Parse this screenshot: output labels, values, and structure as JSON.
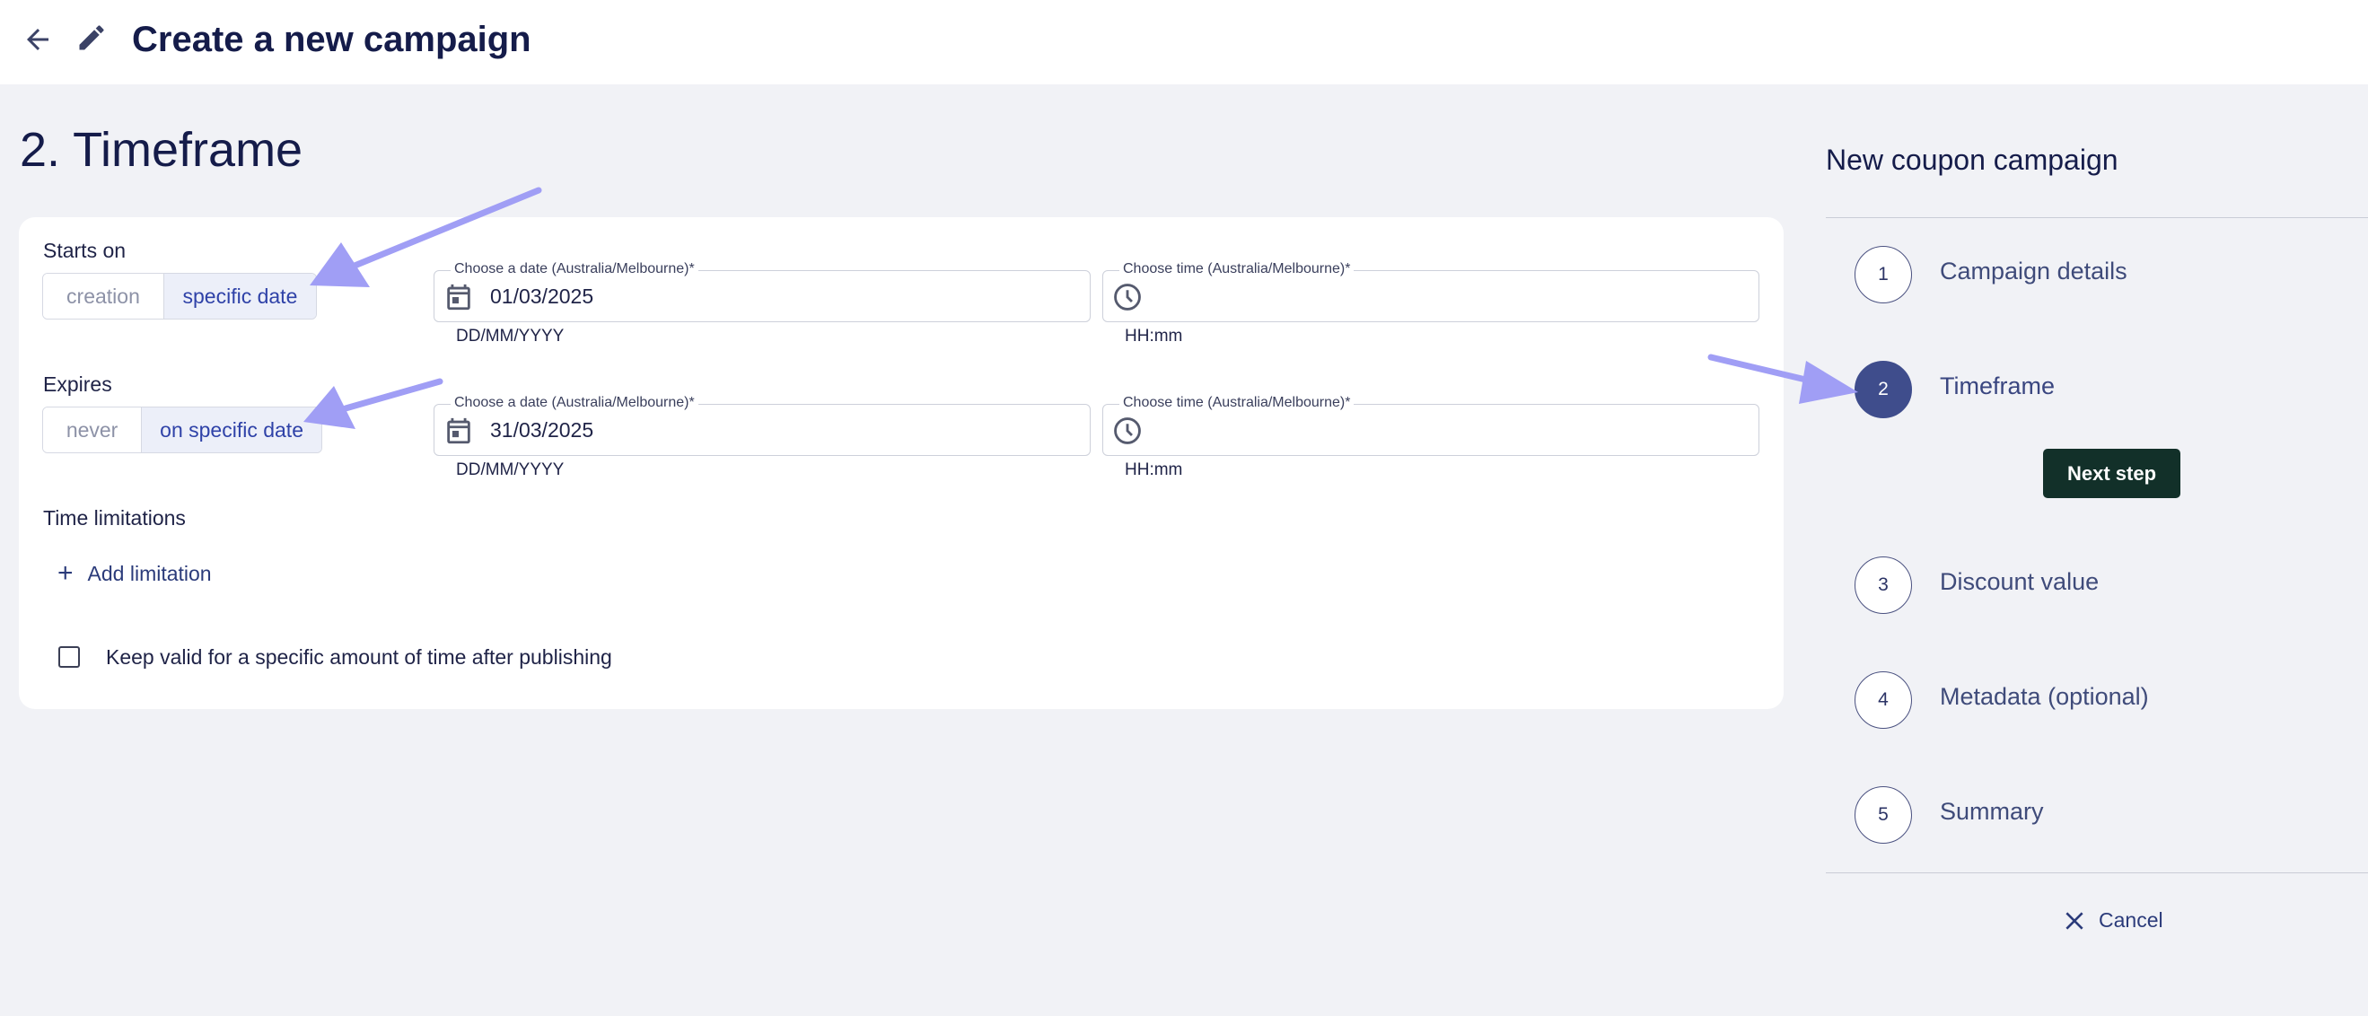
{
  "header": {
    "title": "Create a new campaign"
  },
  "section": {
    "title": "2. Timeframe"
  },
  "starts_on": {
    "label": "Starts on",
    "options": [
      "creation",
      "specific date"
    ],
    "selected": "specific date",
    "date_field": {
      "label": "Choose a date (Australia/Melbourne)*",
      "value": "01/03/2025",
      "helper": "DD/MM/YYYY"
    },
    "time_field": {
      "label": "Choose time (Australia/Melbourne)*",
      "value": "",
      "helper": "HH:mm"
    }
  },
  "expires": {
    "label": "Expires",
    "options": [
      "never",
      "on specific date"
    ],
    "selected": "on specific date",
    "date_field": {
      "label": "Choose a date (Australia/Melbourne)*",
      "value": "31/03/2025",
      "helper": "DD/MM/YYYY"
    },
    "time_field": {
      "label": "Choose time (Australia/Melbourne)*",
      "value": "",
      "helper": "HH:mm"
    }
  },
  "time_limitations": {
    "label": "Time limitations",
    "add_label": "Add limitation"
  },
  "keep_valid": {
    "label": "Keep valid for a specific amount of time after publishing",
    "checked": false
  },
  "sidebar": {
    "title": "New coupon campaign",
    "steps": [
      {
        "number": "1",
        "label": "Campaign details"
      },
      {
        "number": "2",
        "label": "Timeframe"
      },
      {
        "number": "3",
        "label": "Discount value"
      },
      {
        "number": "4",
        "label": "Metadata (optional)"
      },
      {
        "number": "5",
        "label": "Summary"
      }
    ],
    "active_step": "2",
    "next_label": "Next step",
    "cancel_label": "Cancel"
  },
  "colors": {
    "accent": "#3f4d8c",
    "next_button": "#123029",
    "annotation_arrow": "#9f9df5"
  }
}
